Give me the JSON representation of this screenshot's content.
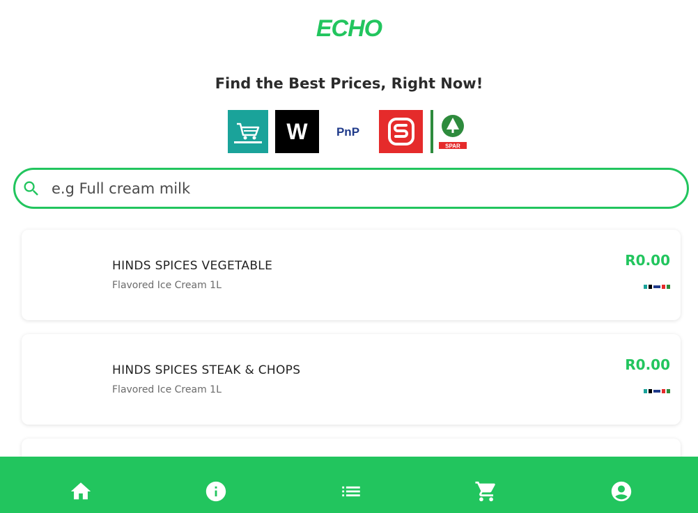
{
  "brand": {
    "name": "ECHO",
    "accent": "#22c55e"
  },
  "tagline": "Find the Best Prices, Right Now!",
  "stores": [
    {
      "name": "Checkers",
      "icon": "checkers-logo"
    },
    {
      "name": "W",
      "icon": "woolworths-logo"
    },
    {
      "name": "PnP",
      "icon": "pnp-logo"
    },
    {
      "name": "Shoprite",
      "icon": "shoprite-logo"
    },
    {
      "name": "SPAR",
      "icon": "spar-logo"
    }
  ],
  "search": {
    "placeholder": "e.g Full cream milk",
    "value": "",
    "icon": "search-icon"
  },
  "products": [
    {
      "name": "HINDS SPICES VEGETABLE",
      "description": "Flavored Ice Cream 1L",
      "price": "R0.00"
    },
    {
      "name": "HINDS SPICES STEAK & CHOPS",
      "description": "Flavored Ice Cream 1L",
      "price": "R0.00"
    }
  ],
  "bottom_nav": [
    {
      "name": "home",
      "icon": "home-icon"
    },
    {
      "name": "info",
      "icon": "info-icon"
    },
    {
      "name": "list",
      "icon": "list-icon"
    },
    {
      "name": "cart",
      "icon": "cart-icon"
    },
    {
      "name": "account",
      "icon": "account-icon"
    }
  ]
}
